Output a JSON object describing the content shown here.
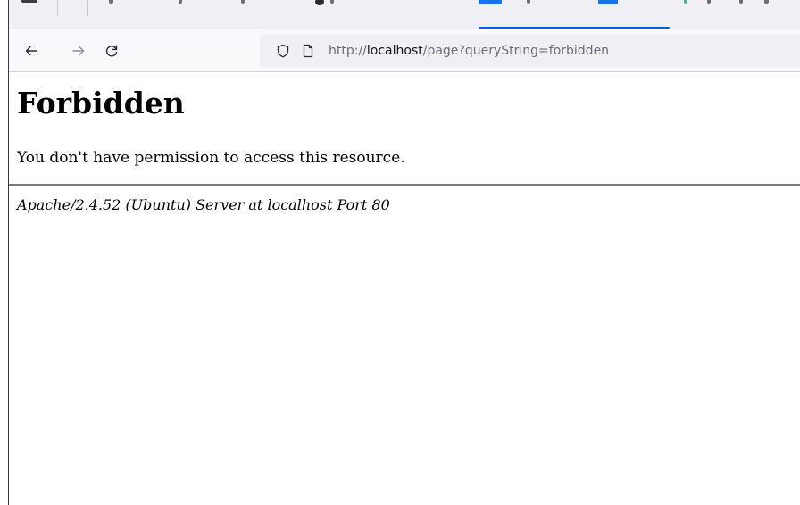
{
  "browser": {
    "url": {
      "scheme": "http://",
      "host": "localhost",
      "path": "/page?queryString=forbidden"
    }
  },
  "page": {
    "heading": "Forbidden",
    "message": "You don't have permission to access this resource.",
    "server_signature": "Apache/2.4.52 (Ubuntu) Server at localhost Port 80"
  },
  "colors": {
    "active_tab_accent": "#0061e0",
    "toolbar_background": "#f9f9fb",
    "urlbar_background": "#f0f0f4"
  },
  "icons": {
    "back": "arrow-left-icon",
    "forward": "arrow-right-icon",
    "reload": "reload-icon",
    "tracking_protection": "shield-icon",
    "page_info": "page-icon"
  }
}
